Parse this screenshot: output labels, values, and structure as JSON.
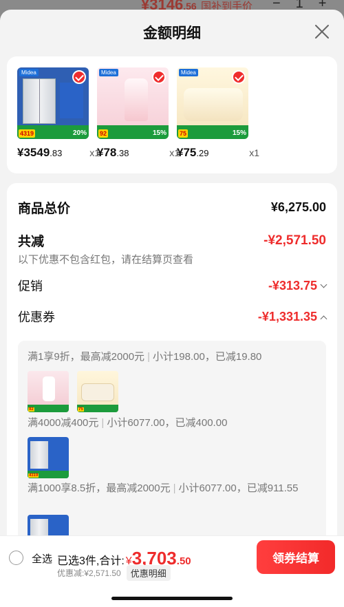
{
  "background": {
    "price_main": "¥3146",
    "price_cents": ".56",
    "note": "国补到手价",
    "stepper": "−1+"
  },
  "sheet": {
    "title": "金额明细"
  },
  "products": [
    {
      "brand": "Midea",
      "promo_tag": "4319",
      "promo_pct": "20%",
      "price_main": "¥3549",
      "price_cents": ".83",
      "qty": "x1"
    },
    {
      "brand": "Midea",
      "promo_tag": "92",
      "promo_pct": "15%",
      "price_main": "¥78",
      "price_cents": ".38",
      "qty": "x1"
    },
    {
      "brand": "Midea",
      "promo_tag": "75",
      "promo_pct": "15%",
      "price_main": "¥75",
      "price_cents": ".29",
      "qty": "x1"
    }
  ],
  "details": {
    "total_label": "商品总价",
    "total_value": "¥6,275.00",
    "reduce_label": "共减",
    "reduce_value": "-¥2,571.50",
    "reduce_note": "以下优惠不包含红包，请在结算页查看",
    "promo_label": "促销",
    "promo_value": "-¥313.75",
    "coupon_label": "优惠券",
    "coupon_value": "-¥1,331.35"
  },
  "coupons": [
    {
      "rule": "满1享9折，最高减2000元",
      "summary": "小计198.00，已减19.80"
    },
    {
      "rule": "满4000减400元",
      "summary": "小计6077.00，已减400.00"
    },
    {
      "rule": "满1000享8.5折，最高减2000元",
      "summary": "小计6077.00，已减911.55"
    }
  ],
  "mini_tags": [
    "92",
    "75",
    "4319",
    "4319"
  ],
  "bottom": {
    "select_all": "全选",
    "selected_prefix": "已选3件,合计:",
    "currency": "¥",
    "total_main": "3,703",
    "total_cents": ".50",
    "discount_text": "优惠减:¥2,571.50",
    "detail_label": "优惠明细",
    "claim_label": "领券结算"
  },
  "colors": {
    "accent_red": "#ee2c2c",
    "promo_green": "#1c9b3c",
    "midea_blue": "#1d6fd8"
  }
}
